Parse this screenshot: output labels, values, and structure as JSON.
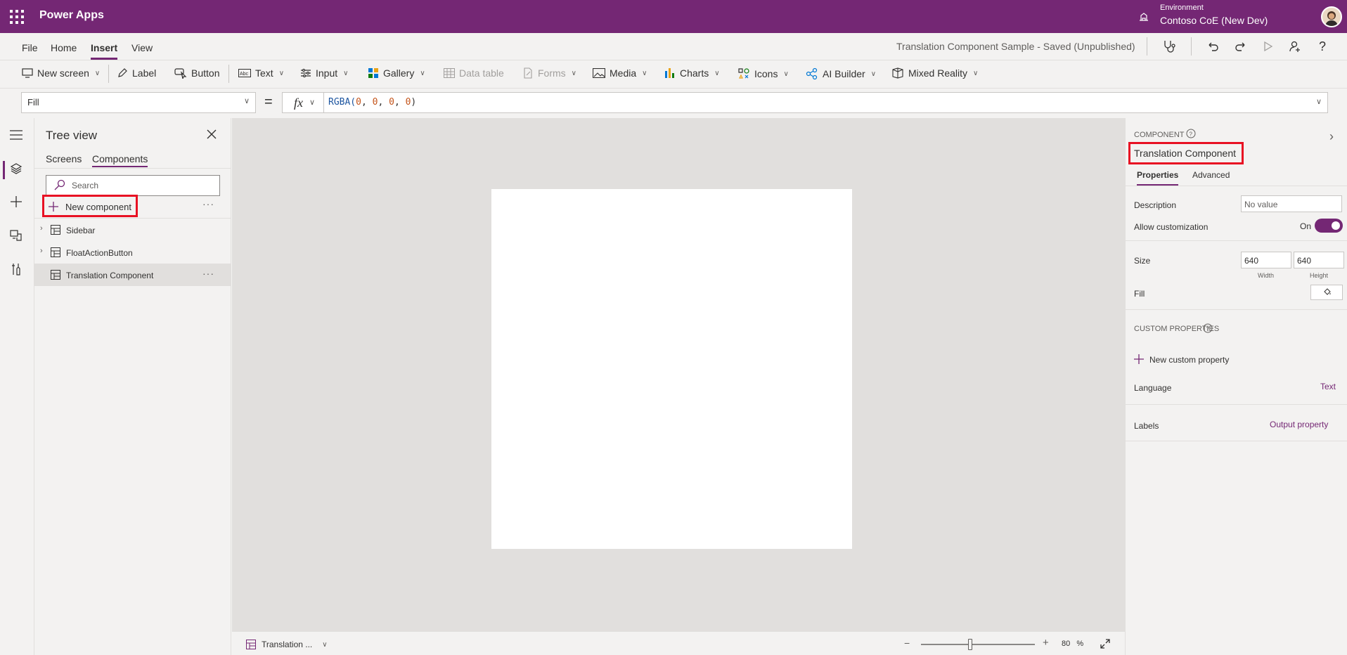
{
  "app": {
    "name": "Power Apps"
  },
  "environment": {
    "label": "Environment",
    "name": "Contoso CoE (New Dev)"
  },
  "menu": {
    "items": [
      "File",
      "Home",
      "Insert",
      "View"
    ],
    "active": "Insert"
  },
  "document": {
    "title": "Translation Component Sample - Saved (Unpublished)"
  },
  "toolbar": {
    "new_screen": "New screen",
    "label": "Label",
    "button": "Button",
    "text": "Text",
    "input": "Input",
    "gallery": "Gallery",
    "data_table": "Data table",
    "forms": "Forms",
    "media": "Media",
    "charts": "Charts",
    "icons": "Icons",
    "ai_builder": "AI Builder",
    "mixed_reality": "Mixed Reality"
  },
  "formula_bar": {
    "property": "Fill",
    "fx": "fx",
    "fn": "RGBA(",
    "args": [
      "0",
      "0",
      "0",
      "0"
    ],
    "close": ")"
  },
  "tree_view": {
    "title": "Tree view",
    "tabs": [
      "Screens",
      "Components"
    ],
    "active_tab": "Components",
    "search_placeholder": "Search",
    "new_component": "New component",
    "items": [
      "Sidebar",
      "FloatActionButton",
      "Translation Component"
    ],
    "selected": "Translation Component"
  },
  "status_bar": {
    "screen": "Translation ...",
    "zoom": "80",
    "zoom_unit": "%"
  },
  "properties_pane": {
    "section": "COMPONENT",
    "component_name": "Translation Component",
    "tabs": [
      "Properties",
      "Advanced"
    ],
    "description_label": "Description",
    "description_placeholder": "No value",
    "allow_customization_label": "Allow customization",
    "allow_customization_state": "On",
    "size_label": "Size",
    "width": "640",
    "height": "640",
    "width_label": "Width",
    "height_label": "Height",
    "fill_label": "Fill",
    "custom_properties": "CUSTOM PROPERTIES",
    "new_custom_property": "New custom property",
    "language_label": "Language",
    "language_type": "Text",
    "labels_label": "Labels",
    "labels_type": "Output property"
  },
  "colors": {
    "brand": "#742774",
    "highlight": "#e81123"
  }
}
